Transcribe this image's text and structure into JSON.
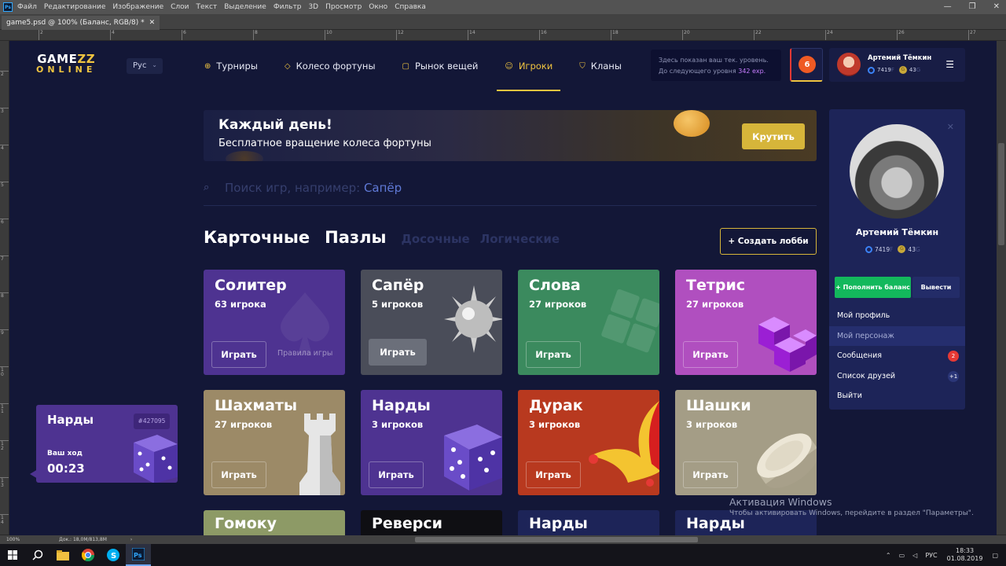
{
  "ps": {
    "menu": [
      "Файл",
      "Редактирование",
      "Изображение",
      "Слои",
      "Текст",
      "Выделение",
      "Фильтр",
      "3D",
      "Просмотр",
      "Окно",
      "Справка"
    ],
    "logo": "Ps",
    "doc_tab": "game5.psd @ 100% (Баланс, RGB/8) *",
    "zoom": "100%",
    "doc_size": "Док.: 18,0M/813,8M",
    "ruler_top": [
      "2",
      "4",
      "6",
      "8",
      "10",
      "12",
      "14",
      "16",
      "18",
      "20",
      "22",
      "24",
      "26",
      "27"
    ],
    "ruler_left": [
      "2",
      "3",
      "4",
      "5",
      "6",
      "7",
      "8",
      "9",
      "10",
      "11",
      "12",
      "13",
      "14",
      "15"
    ]
  },
  "taskbar": {
    "lang": "РУС",
    "time": "18:33",
    "date": "01.08.2019"
  },
  "site": {
    "logo_top": "GAME",
    "logo_zz": "ZZ",
    "logo_bottom": "ONLINE",
    "lang": "Рус",
    "nav": [
      {
        "label": "Турниры",
        "icon": "trophy-icon"
      },
      {
        "label": "Колесо фортуны",
        "icon": "diamond-icon"
      },
      {
        "label": "Рынок вещей",
        "icon": "shirt-icon"
      },
      {
        "label": "Игроки",
        "icon": "players-icon"
      },
      {
        "label": "Кланы",
        "icon": "shield-icon"
      }
    ],
    "level_line1": "Здесь показан ваш тек. уровень.",
    "level_line2_prefix": "До следующего уровня",
    "level_exp": "342 exp.",
    "level": "6",
    "user_name": "Артемий Тёмкин",
    "balance_blue": "7419",
    "balance_gold": "43",
    "balance_suffix_blue": "F",
    "balance_suffix_gold": "G",
    "gold_coin_letter": "G"
  },
  "banner": {
    "title": "Каждый день!",
    "subtitle": "Бесплатное вращение колеса фортуны",
    "button": "Крутить"
  },
  "search": {
    "placeholder": "Поиск игр, например:",
    "example": "Сапёр"
  },
  "categories": [
    {
      "label": "Карточные",
      "active": true
    },
    {
      "label": "Пазлы",
      "active": true
    },
    {
      "label": "Досочные",
      "active": false
    },
    {
      "label": "Логические",
      "active": false
    }
  ],
  "create_lobby": "+ Создать лобби",
  "play_label": "Играть",
  "rules_label": "Правила игры",
  "games": [
    {
      "title": "Солитер",
      "players": "63 игрока",
      "color": "#4e3391"
    },
    {
      "title": "Сапёр",
      "players": "5 игроков",
      "color": "#4a4d59"
    },
    {
      "title": "Слова",
      "players": "27 игроков",
      "color": "#3b8a5e"
    },
    {
      "title": "Тетрис",
      "players": "27 игроков",
      "color": "#b04fbf"
    },
    {
      "title": "Шахматы",
      "players": "27 игроков",
      "color": "#9c8a67"
    },
    {
      "title": "Нарды",
      "players": "3 игроков",
      "color": "#4e3391"
    },
    {
      "title": "Дурак",
      "players": "3 игроков",
      "color": "#b8391f"
    },
    {
      "title": "Шашки",
      "players": "3 игроков",
      "color": "#a49d86"
    },
    {
      "title": "Гомоку",
      "color": "#8d9a66"
    },
    {
      "title": "Реверси",
      "color": "#0f0f13"
    },
    {
      "title": "Нарды",
      "color": "#1d2458"
    },
    {
      "title": "Нарды",
      "color": "#1d2458"
    }
  ],
  "mini_game": {
    "title": "Нарды",
    "id": "#427095",
    "turn": "Ваш ход",
    "time": "00:23"
  },
  "profile": {
    "name": "Артемий Тёмкин",
    "topup": "+ Пополнить баланс",
    "withdraw": "Вывести",
    "menu": [
      {
        "label": "Мой профиль"
      },
      {
        "label": "Мой персонаж"
      },
      {
        "label": "Сообщения",
        "badge": "2"
      },
      {
        "label": "Список друзей",
        "badge": "+1"
      },
      {
        "label": "Выйти"
      }
    ]
  },
  "activation": {
    "line1": "Активация Windows",
    "line2": "Чтобы активировать Windows, перейдите в раздел \"Параметры\"."
  }
}
